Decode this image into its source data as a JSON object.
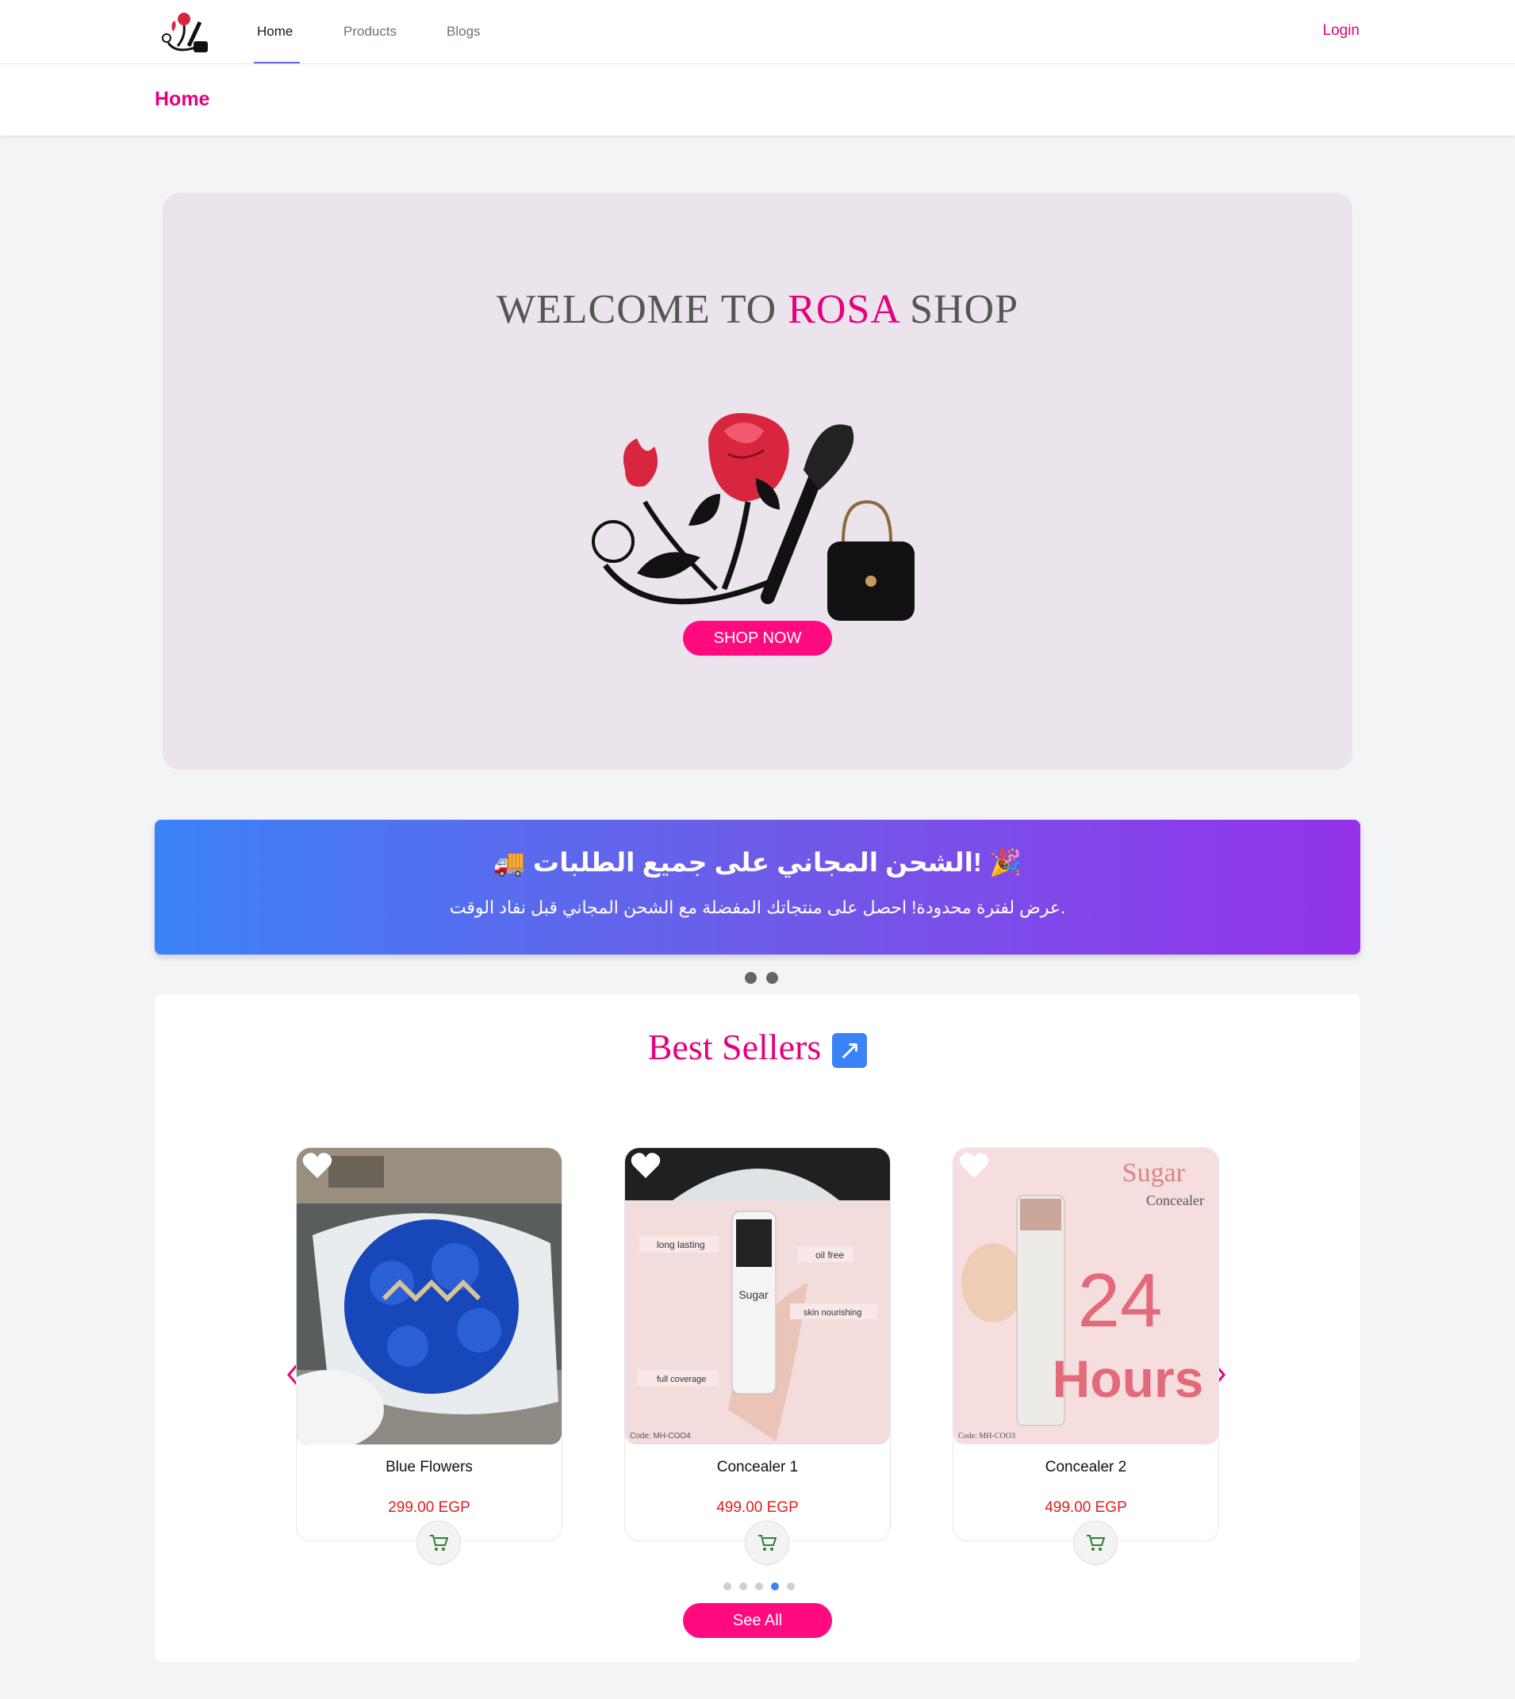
{
  "nav": {
    "items": [
      {
        "label": "Home",
        "active": true
      },
      {
        "label": "Products",
        "active": false
      },
      {
        "label": "Blogs",
        "active": false
      }
    ],
    "login": "Login"
  },
  "page": {
    "title": "Home"
  },
  "hero": {
    "title_prefix": "WELCOME TO ",
    "title_accent": "ROSA",
    "title_suffix": " SHOP",
    "cta": "SHOP NOW"
  },
  "promo": {
    "title": "🎉 !الشحن المجاني على جميع الطلبات 🚚",
    "subtitle": ".عرض لفترة محدودة! احصل على منتجاتك المفضلة مع الشحن المجاني قبل نفاد الوقت"
  },
  "best_sellers": {
    "title": "Best Sellers",
    "icon": "arrow-up-right-icon",
    "products": [
      {
        "name": "Blue Flowers",
        "price": "299.00 EGP"
      },
      {
        "name": "Concealer 1",
        "price": "499.00 EGP"
      },
      {
        "name": "Concealer 2",
        "price": "499.00 EGP"
      }
    ],
    "image_text": {
      "concealer1_tags": [
        "long lasting",
        "oil free",
        "skin nourishing",
        "full coverage"
      ],
      "concealer1_code": "Code: MH-COO4",
      "concealer2_brand": "Sugar",
      "concealer2_sub": "Concealer",
      "concealer2_big": "24",
      "concealer2_hours": "Hours",
      "concealer2_code": "Code: MH-COO3"
    },
    "see_all": "See All",
    "active_page": 3
  },
  "colors": {
    "brand": "#e6007e",
    "button": "#ff0a7f",
    "price": "#e11d1d"
  }
}
